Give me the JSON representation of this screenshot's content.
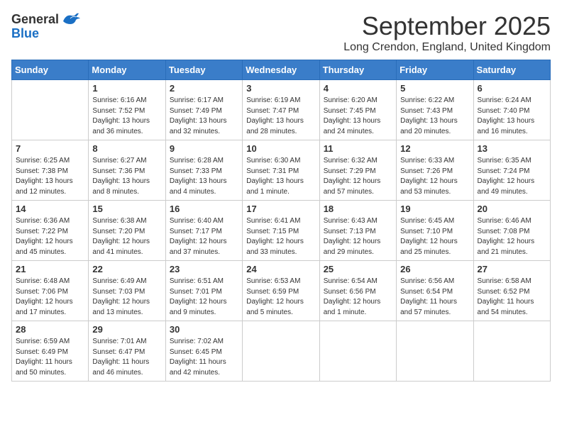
{
  "header": {
    "logo_general": "General",
    "logo_blue": "Blue",
    "month_title": "September 2025",
    "location": "Long Crendon, England, United Kingdom"
  },
  "days_of_week": [
    "Sunday",
    "Monday",
    "Tuesday",
    "Wednesday",
    "Thursday",
    "Friday",
    "Saturday"
  ],
  "weeks": [
    [
      {
        "day": "",
        "info": ""
      },
      {
        "day": "1",
        "info": "Sunrise: 6:16 AM\nSunset: 7:52 PM\nDaylight: 13 hours\nand 36 minutes."
      },
      {
        "day": "2",
        "info": "Sunrise: 6:17 AM\nSunset: 7:49 PM\nDaylight: 13 hours\nand 32 minutes."
      },
      {
        "day": "3",
        "info": "Sunrise: 6:19 AM\nSunset: 7:47 PM\nDaylight: 13 hours\nand 28 minutes."
      },
      {
        "day": "4",
        "info": "Sunrise: 6:20 AM\nSunset: 7:45 PM\nDaylight: 13 hours\nand 24 minutes."
      },
      {
        "day": "5",
        "info": "Sunrise: 6:22 AM\nSunset: 7:43 PM\nDaylight: 13 hours\nand 20 minutes."
      },
      {
        "day": "6",
        "info": "Sunrise: 6:24 AM\nSunset: 7:40 PM\nDaylight: 13 hours\nand 16 minutes."
      }
    ],
    [
      {
        "day": "7",
        "info": "Sunrise: 6:25 AM\nSunset: 7:38 PM\nDaylight: 13 hours\nand 12 minutes."
      },
      {
        "day": "8",
        "info": "Sunrise: 6:27 AM\nSunset: 7:36 PM\nDaylight: 13 hours\nand 8 minutes."
      },
      {
        "day": "9",
        "info": "Sunrise: 6:28 AM\nSunset: 7:33 PM\nDaylight: 13 hours\nand 4 minutes."
      },
      {
        "day": "10",
        "info": "Sunrise: 6:30 AM\nSunset: 7:31 PM\nDaylight: 13 hours\nand 1 minute."
      },
      {
        "day": "11",
        "info": "Sunrise: 6:32 AM\nSunset: 7:29 PM\nDaylight: 12 hours\nand 57 minutes."
      },
      {
        "day": "12",
        "info": "Sunrise: 6:33 AM\nSunset: 7:26 PM\nDaylight: 12 hours\nand 53 minutes."
      },
      {
        "day": "13",
        "info": "Sunrise: 6:35 AM\nSunset: 7:24 PM\nDaylight: 12 hours\nand 49 minutes."
      }
    ],
    [
      {
        "day": "14",
        "info": "Sunrise: 6:36 AM\nSunset: 7:22 PM\nDaylight: 12 hours\nand 45 minutes."
      },
      {
        "day": "15",
        "info": "Sunrise: 6:38 AM\nSunset: 7:20 PM\nDaylight: 12 hours\nand 41 minutes."
      },
      {
        "day": "16",
        "info": "Sunrise: 6:40 AM\nSunset: 7:17 PM\nDaylight: 12 hours\nand 37 minutes."
      },
      {
        "day": "17",
        "info": "Sunrise: 6:41 AM\nSunset: 7:15 PM\nDaylight: 12 hours\nand 33 minutes."
      },
      {
        "day": "18",
        "info": "Sunrise: 6:43 AM\nSunset: 7:13 PM\nDaylight: 12 hours\nand 29 minutes."
      },
      {
        "day": "19",
        "info": "Sunrise: 6:45 AM\nSunset: 7:10 PM\nDaylight: 12 hours\nand 25 minutes."
      },
      {
        "day": "20",
        "info": "Sunrise: 6:46 AM\nSunset: 7:08 PM\nDaylight: 12 hours\nand 21 minutes."
      }
    ],
    [
      {
        "day": "21",
        "info": "Sunrise: 6:48 AM\nSunset: 7:06 PM\nDaylight: 12 hours\nand 17 minutes."
      },
      {
        "day": "22",
        "info": "Sunrise: 6:49 AM\nSunset: 7:03 PM\nDaylight: 12 hours\nand 13 minutes."
      },
      {
        "day": "23",
        "info": "Sunrise: 6:51 AM\nSunset: 7:01 PM\nDaylight: 12 hours\nand 9 minutes."
      },
      {
        "day": "24",
        "info": "Sunrise: 6:53 AM\nSunset: 6:59 PM\nDaylight: 12 hours\nand 5 minutes."
      },
      {
        "day": "25",
        "info": "Sunrise: 6:54 AM\nSunset: 6:56 PM\nDaylight: 12 hours\nand 1 minute."
      },
      {
        "day": "26",
        "info": "Sunrise: 6:56 AM\nSunset: 6:54 PM\nDaylight: 11 hours\nand 57 minutes."
      },
      {
        "day": "27",
        "info": "Sunrise: 6:58 AM\nSunset: 6:52 PM\nDaylight: 11 hours\nand 54 minutes."
      }
    ],
    [
      {
        "day": "28",
        "info": "Sunrise: 6:59 AM\nSunset: 6:49 PM\nDaylight: 11 hours\nand 50 minutes."
      },
      {
        "day": "29",
        "info": "Sunrise: 7:01 AM\nSunset: 6:47 PM\nDaylight: 11 hours\nand 46 minutes."
      },
      {
        "day": "30",
        "info": "Sunrise: 7:02 AM\nSunset: 6:45 PM\nDaylight: 11 hours\nand 42 minutes."
      },
      {
        "day": "",
        "info": ""
      },
      {
        "day": "",
        "info": ""
      },
      {
        "day": "",
        "info": ""
      },
      {
        "day": "",
        "info": ""
      }
    ]
  ]
}
